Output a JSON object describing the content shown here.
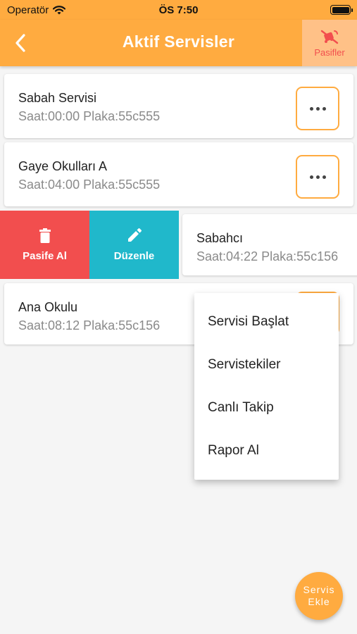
{
  "status_bar": {
    "carrier": "Operatör",
    "time": "ÖS 7:50"
  },
  "app_bar": {
    "title": "Aktif Servisler",
    "pasifler_label": "Pasifler"
  },
  "services": [
    {
      "name": "Sabah Servisi",
      "meta": "Saat:00:00 Plaka:55c555"
    },
    {
      "name": "Gaye Okulları A",
      "meta": "Saat:04:00 Plaka:55c555"
    },
    {
      "name": "Sabahcı",
      "meta": "Saat:04:22 Plaka:55c156"
    },
    {
      "name": "Ana Okulu",
      "meta": "Saat:08:12 Plaka:55c156"
    }
  ],
  "swipe_actions": {
    "deactivate_label": "Pasife Al",
    "edit_label": "Düzenle"
  },
  "context_menu": {
    "items": [
      "Servisi Başlat",
      "Servistekiler",
      "Canlı Takip",
      "Rapor Al"
    ]
  },
  "fab": {
    "label": "Servis Ekle"
  },
  "colors": {
    "primary": "#ffab40",
    "pasifler_bg": "#ffc187",
    "danger": "#f24e4e",
    "teal": "#20b8cb"
  }
}
